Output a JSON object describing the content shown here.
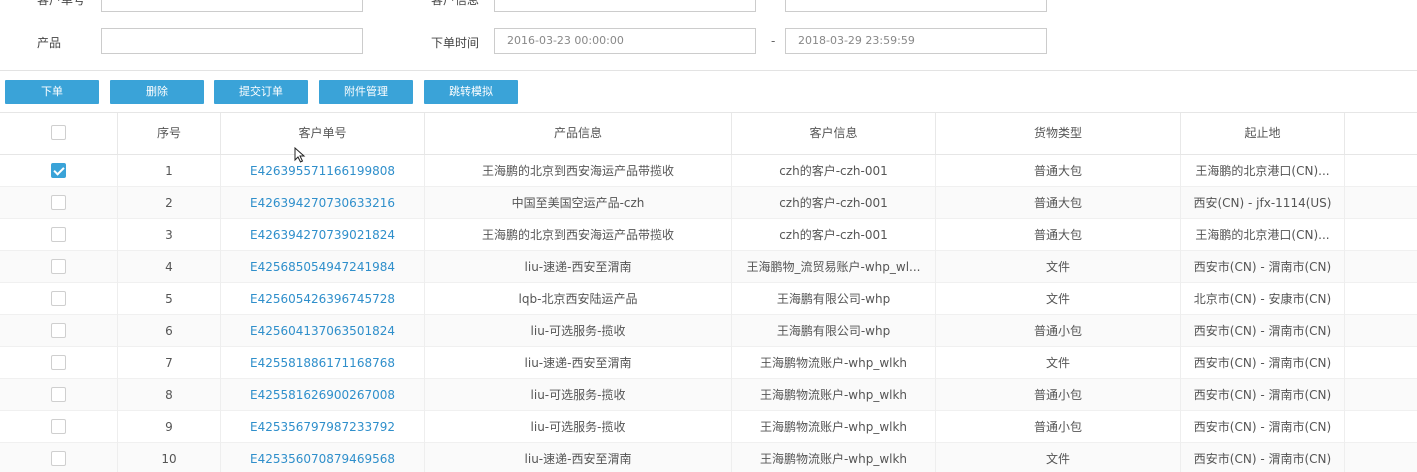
{
  "filters": {
    "customer_order_no_label": "客户单号",
    "customer_info_label": "客户信息",
    "product_label": "产品",
    "order_time_label": "下单时间",
    "order_time_start": "2016-03-23 00:00:00",
    "order_time_end": "2018-03-29 23:59:59",
    "range_separator": "-"
  },
  "toolbar": {
    "place_order": "下单",
    "delete": "删除",
    "submit_order": "提交订单",
    "attachment_manage": "附件管理",
    "jump_simulate": "跳转模拟"
  },
  "table": {
    "headers": [
      "序号",
      "客户单号",
      "产品信息",
      "客户信息",
      "货物类型",
      "起止地"
    ],
    "rows": [
      {
        "checked": true,
        "seq": "1",
        "order_no": "E426395571166199808",
        "product": "王海鹏的北京到西安海运产品带揽收",
        "customer": "czh的客户-czh-001",
        "cargo": "普通大包",
        "route": "王海鹏的北京港口(CN)..."
      },
      {
        "checked": false,
        "seq": "2",
        "order_no": "E426394270730633216",
        "product": "中国至美国空运产品-czh",
        "customer": "czh的客户-czh-001",
        "cargo": "普通大包",
        "route": "西安(CN) - jfx-1114(US)"
      },
      {
        "checked": false,
        "seq": "3",
        "order_no": "E426394270739021824",
        "product": "王海鹏的北京到西安海运产品带揽收",
        "customer": "czh的客户-czh-001",
        "cargo": "普通大包",
        "route": "王海鹏的北京港口(CN)..."
      },
      {
        "checked": false,
        "seq": "4",
        "order_no": "E425685054947241984",
        "product": "liu-速递-西安至渭南",
        "customer": "王海鹏物_流贸易账户-whp_wl...",
        "cargo": "文件",
        "route": "西安市(CN) - 渭南市(CN)"
      },
      {
        "checked": false,
        "seq": "5",
        "order_no": "E425605426396745728",
        "product": "lqb-北京西安陆运产品",
        "customer": "王海鹏有限公司-whp",
        "cargo": "文件",
        "route": "北京市(CN) - 安康市(CN)"
      },
      {
        "checked": false,
        "seq": "6",
        "order_no": "E425604137063501824",
        "product": "liu-可选服务-揽收",
        "customer": "王海鹏有限公司-whp",
        "cargo": "普通小包",
        "route": "西安市(CN) - 渭南市(CN)"
      },
      {
        "checked": false,
        "seq": "7",
        "order_no": "E425581886171168768",
        "product": "liu-速递-西安至渭南",
        "customer": "王海鹏物流账户-whp_wlkh",
        "cargo": "文件",
        "route": "西安市(CN) - 渭南市(CN)"
      },
      {
        "checked": false,
        "seq": "8",
        "order_no": "E425581626900267008",
        "product": "liu-可选服务-揽收",
        "customer": "王海鹏物流账户-whp_wlkh",
        "cargo": "普通小包",
        "route": "西安市(CN) - 渭南市(CN)"
      },
      {
        "checked": false,
        "seq": "9",
        "order_no": "E425356797987233792",
        "product": "liu-可选服务-揽收",
        "customer": "王海鹏物流账户-whp_wlkh",
        "cargo": "普通小包",
        "route": "西安市(CN) - 渭南市(CN)"
      },
      {
        "checked": false,
        "seq": "10",
        "order_no": "E425356070879469568",
        "product": "liu-速递-西安至渭南",
        "customer": "王海鹏物流账户-whp_wlkh",
        "cargo": "文件",
        "route": "西安市(CN) - 渭南市(CN)"
      }
    ]
  },
  "colors": {
    "accent": "#3aa3d8",
    "link": "#2f8fcb"
  }
}
